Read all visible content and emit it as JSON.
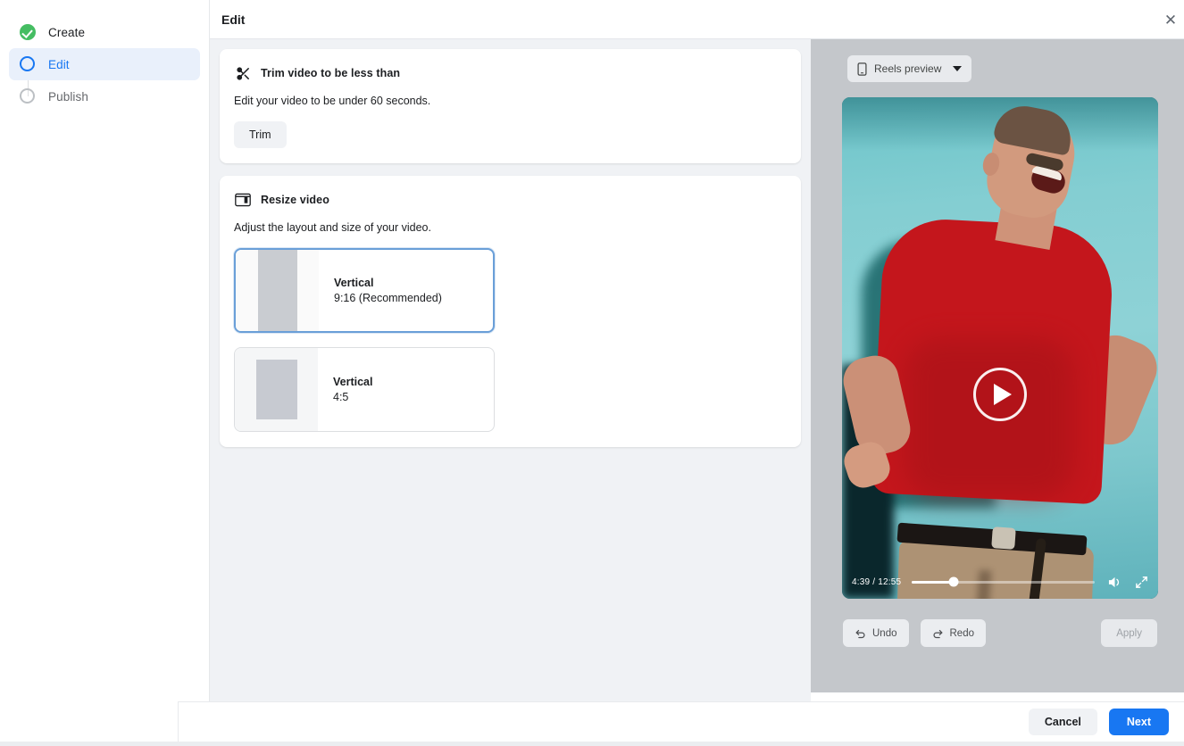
{
  "header": {
    "title": "Edit",
    "close_icon": "close-icon"
  },
  "sidebar": {
    "steps": [
      {
        "label": "Create",
        "state": "complete",
        "icon": "check-circle-icon"
      },
      {
        "label": "Edit",
        "state": "active",
        "icon": "circle-icon"
      },
      {
        "label": "Publish",
        "state": "pending",
        "icon": "circle-icon"
      }
    ]
  },
  "main": {
    "trim_card": {
      "icon": "scissors-icon",
      "title": "Trim video to be less than",
      "description": "Edit your video to be under 60 seconds.",
      "button_label": "Trim"
    },
    "resize_card": {
      "icon": "resize-layout-icon",
      "title": "Resize video",
      "description": "Adjust the layout and size of your video.",
      "options": [
        {
          "title": "Vertical",
          "subtitle": "9:16 (Recommended)",
          "selected": true
        },
        {
          "title": "Vertical",
          "subtitle": "4:5",
          "selected": false
        }
      ]
    }
  },
  "preview": {
    "selector": {
      "icon": "phone-icon",
      "label": "Reels preview",
      "caret": "chevron-down-icon"
    },
    "player": {
      "play_icon": "play-icon",
      "current_time": "4:39",
      "duration": "12:55",
      "time_display": "4:39 / 12:55",
      "progress_percent": 23,
      "volume_icon": "volume-icon",
      "fullscreen_icon": "expand-icon"
    },
    "actions": {
      "undo_label": "Undo",
      "undo_icon": "undo-icon",
      "redo_label": "Redo",
      "redo_icon": "redo-icon",
      "apply_label": "Apply",
      "apply_disabled": true
    }
  },
  "footer": {
    "cancel_label": "Cancel",
    "next_label": "Next"
  },
  "colors": {
    "accent_blue": "#1877f2",
    "success_green": "#45bd62",
    "panel_gray": "#f0f2f5",
    "preview_gray": "#c4c7cb",
    "selected_border": "#6a9fd8"
  }
}
